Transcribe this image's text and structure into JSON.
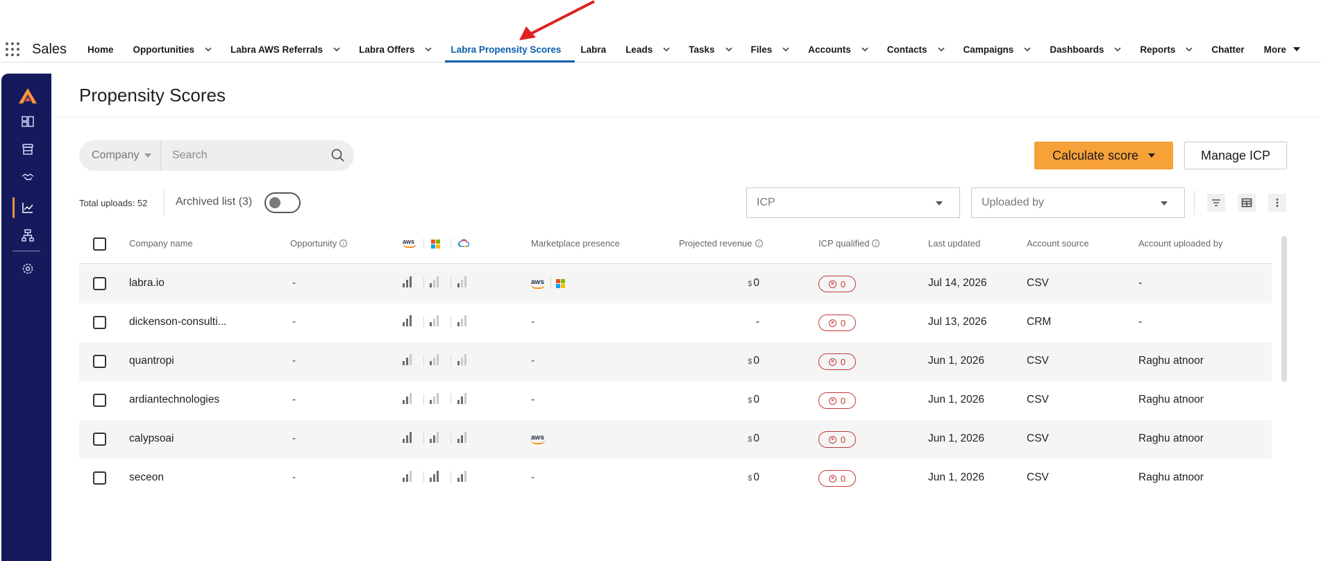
{
  "app": {
    "name": "Sales"
  },
  "nav": {
    "items": [
      {
        "label": "Home",
        "has_menu": false,
        "active": false
      },
      {
        "label": "Opportunities",
        "has_menu": true,
        "active": false
      },
      {
        "label": "Labra AWS Referrals",
        "has_menu": true,
        "active": false
      },
      {
        "label": "Labra Offers",
        "has_menu": true,
        "active": false
      },
      {
        "label": "Labra Propensity Scores",
        "has_menu": false,
        "active": true
      },
      {
        "label": "Labra",
        "has_menu": false,
        "active": false
      },
      {
        "label": "Leads",
        "has_menu": true,
        "active": false
      },
      {
        "label": "Tasks",
        "has_menu": true,
        "active": false
      },
      {
        "label": "Files",
        "has_menu": true,
        "active": false
      },
      {
        "label": "Accounts",
        "has_menu": true,
        "active": false
      },
      {
        "label": "Contacts",
        "has_menu": true,
        "active": false
      },
      {
        "label": "Campaigns",
        "has_menu": true,
        "active": false
      },
      {
        "label": "Dashboards",
        "has_menu": true,
        "active": false
      },
      {
        "label": "Reports",
        "has_menu": true,
        "active": false
      },
      {
        "label": "Chatter",
        "has_menu": false,
        "active": false
      }
    ],
    "more_label": "More"
  },
  "page": {
    "title": "Propensity Scores"
  },
  "search": {
    "filter_label": "Company",
    "placeholder": "Search"
  },
  "actions": {
    "calculate_label": "Calculate score",
    "manage_icp_label": "Manage ICP"
  },
  "toolbar": {
    "total_uploads": "Total uploads: 52",
    "archived_label": "Archived list (3)",
    "archived_on": false,
    "icp_placeholder": "ICP",
    "uploaded_by_placeholder": "Uploaded by"
  },
  "table": {
    "headers": {
      "company": "Company name",
      "opportunity": "Opportunity",
      "marketplace": "Marketplace presence",
      "revenue": "Projected revenue",
      "icp": "ICP qualified",
      "updated": "Last updated",
      "source": "Account source",
      "uploaded_by": "Account uploaded by"
    },
    "cloud_icons": [
      "aws-icon",
      "microsoft-icon",
      "google-cloud-icon"
    ],
    "rows": [
      {
        "company": "labra.io",
        "opportunity": "-",
        "scores": [
          3,
          1,
          1
        ],
        "marketplace": [
          "aws",
          "microsoft"
        ],
        "revenue_symbol": "$",
        "revenue": "0",
        "icp": "0",
        "updated": "Jul 14, 2026",
        "source": "CSV",
        "uploaded_by": "-"
      },
      {
        "company": "dickenson-consulti...",
        "opportunity": "-",
        "scores": [
          3,
          1,
          1
        ],
        "marketplace": [],
        "revenue_symbol": "",
        "revenue": "-",
        "icp": "0",
        "updated": "Jul 13, 2026",
        "source": "CRM",
        "uploaded_by": "-"
      },
      {
        "company": "quantropi",
        "opportunity": "-",
        "scores": [
          2,
          1,
          1
        ],
        "marketplace": [],
        "revenue_symbol": "$",
        "revenue": "0",
        "icp": "0",
        "updated": "Jun 1, 2026",
        "source": "CSV",
        "uploaded_by": "Raghu atnoor"
      },
      {
        "company": "ardiantechnologies",
        "opportunity": "-",
        "scores": [
          2,
          1,
          2
        ],
        "marketplace": [],
        "revenue_symbol": "$",
        "revenue": "0",
        "icp": "0",
        "updated": "Jun 1, 2026",
        "source": "CSV",
        "uploaded_by": "Raghu atnoor"
      },
      {
        "company": "calypsoai",
        "opportunity": "-",
        "scores": [
          3,
          2,
          2
        ],
        "marketplace": [
          "aws"
        ],
        "revenue_symbol": "$",
        "revenue": "0",
        "icp": "0",
        "updated": "Jun 1, 2026",
        "source": "CSV",
        "uploaded_by": "Raghu atnoor"
      },
      {
        "company": "seceon",
        "opportunity": "-",
        "scores": [
          2,
          3,
          2
        ],
        "marketplace": [],
        "revenue_symbol": "$",
        "revenue": "0",
        "icp": "0",
        "updated": "Jun 1, 2026",
        "source": "CSV",
        "uploaded_by": "Raghu atnoor"
      }
    ]
  },
  "colors": {
    "active_tab": "#0b5cab",
    "sidebar_bg": "#141a5c",
    "accent_orange": "#f7a139",
    "icp_red": "#c23934",
    "annotation_arrow": "#e02020"
  }
}
